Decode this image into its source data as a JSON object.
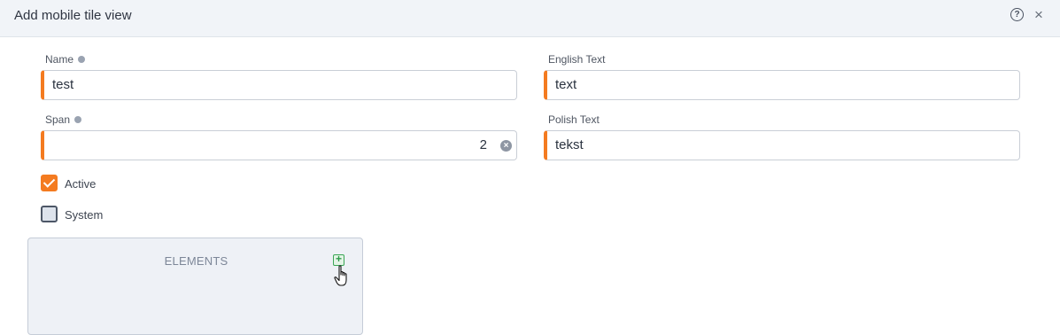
{
  "dialog": {
    "title": "Add mobile tile view",
    "help_icon": "question-circle-icon",
    "close_icon": "close-icon",
    "help_glyph": "?",
    "close_glyph": "×"
  },
  "form": {
    "name": {
      "label": "Name",
      "value": "test"
    },
    "span": {
      "label": "Span",
      "value": "2",
      "clear_glyph": "×"
    },
    "english_text": {
      "label": "English Text",
      "value": "text"
    },
    "polish_text": {
      "label": "Polish Text",
      "value": "tekst"
    },
    "active": {
      "label": "Active",
      "checked": true
    },
    "system": {
      "label": "System",
      "checked": false
    }
  },
  "elements": {
    "title": "ELEMENTS",
    "add_icon": "plus-square-icon",
    "add_glyph": "+"
  },
  "colors": {
    "accent": "#f47b20",
    "header_bg": "#f1f4f8",
    "add_green": "#3aa655"
  }
}
